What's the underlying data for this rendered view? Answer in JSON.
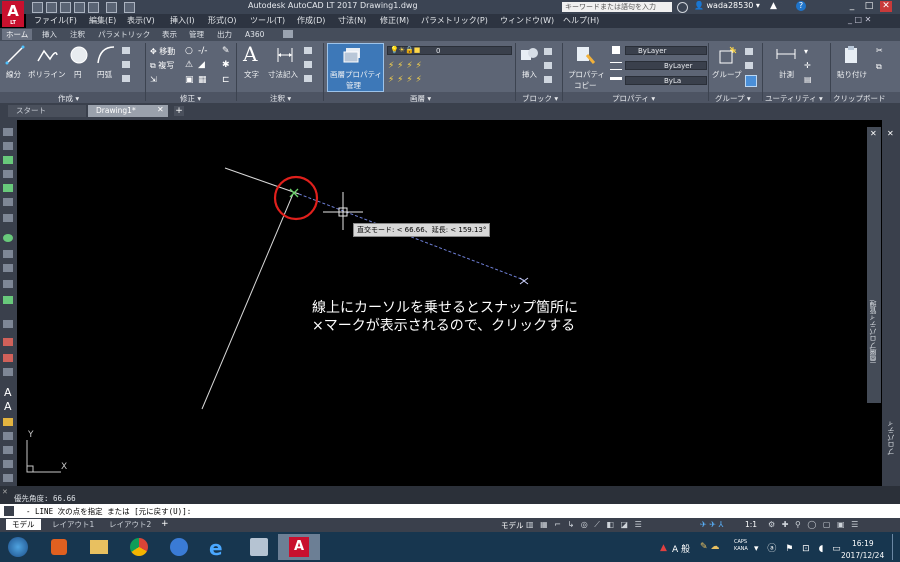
{
  "title_bar": {
    "app_logo": "A",
    "app_logo_sub": "LT",
    "title": "Autodesk AutoCAD LT 2017    Drawing1.dwg",
    "search_placeholder": "キーワードまたは語句を入力",
    "username": "wada28530"
  },
  "menus": [
    "ファイル(F)",
    "編集(E)",
    "表示(V)",
    "挿入(I)",
    "形式(O)",
    "ツール(T)",
    "作成(D)",
    "寸法(N)",
    "修正(M)",
    "パラメトリック(P)",
    "ウィンドウ(W)",
    "ヘルプ(H)"
  ],
  "ribbon_tabs": [
    "ホーム",
    "挿入",
    "注釈",
    "パラメトリック",
    "表示",
    "管理",
    "出力",
    "A360"
  ],
  "ribbon": {
    "draw": {
      "line": "線分",
      "polyline": "ポリライン",
      "circle": "円",
      "arc": "円弧"
    },
    "modify": {
      "move": "移動",
      "copy": "複写"
    },
    "annotation": {
      "text": "文字",
      "dimension": "寸法記入"
    },
    "layers": {
      "properties_line1": "画層プロパティ",
      "properties_line2": "管理",
      "current_layer": "0"
    },
    "block": {
      "insert": "挿入"
    },
    "properties": {
      "match_line1": "プロパティ",
      "match_line2": "コピー",
      "color": "ByLayer",
      "linetype": "ByLayer",
      "lineweight": "ByLa"
    },
    "groups": {
      "group": "グループ"
    },
    "utilities": {
      "measure": "計測"
    },
    "clipboard": {
      "paste": "貼り付け"
    }
  },
  "panel_names": [
    "作成 ▾",
    "修正 ▾",
    "注釈 ▾",
    "画層 ▾",
    "ブロック ▾",
    "プロパティ ▾",
    "グループ ▾",
    "ユーティリティ ▾",
    "クリップボード"
  ],
  "doc_tabs": [
    "スタート",
    "Drawing1*"
  ],
  "canvas": {
    "tooltip": "直交モード: < 66.66、延長: < 159.13°",
    "annotation_line1": "線上にカーソルを乗せるとスナップ箇所に",
    "annotation_line2": "×マークが表示されるので、クリックする",
    "ucs_y": "Y",
    "ucs_x": "X"
  },
  "right_panel_label": "画層プロパティ管理",
  "right_panel_label2": "プロパティ",
  "command": {
    "history": "優先角度: 66.66",
    "prompt": "- LINE 次の点を指定 または [元に戻す(U)]:"
  },
  "layout_tabs": [
    "モデル",
    "レイアウト1",
    "レイアウト2"
  ],
  "status": {
    "model": "モデル",
    "scale": "1:1"
  },
  "taskbar": {
    "ime": "A 般",
    "caps": "CAPS",
    "kana": "KANA",
    "time": "16:19",
    "date": "2017/12/24"
  },
  "colors": {
    "title_bar": "#3b4453",
    "ribbon": "#5d6575",
    "canvas": "#000000",
    "highlight_circle": "#e0201c",
    "taskbar": "#17364f",
    "autocad_red": "#c8102e"
  }
}
